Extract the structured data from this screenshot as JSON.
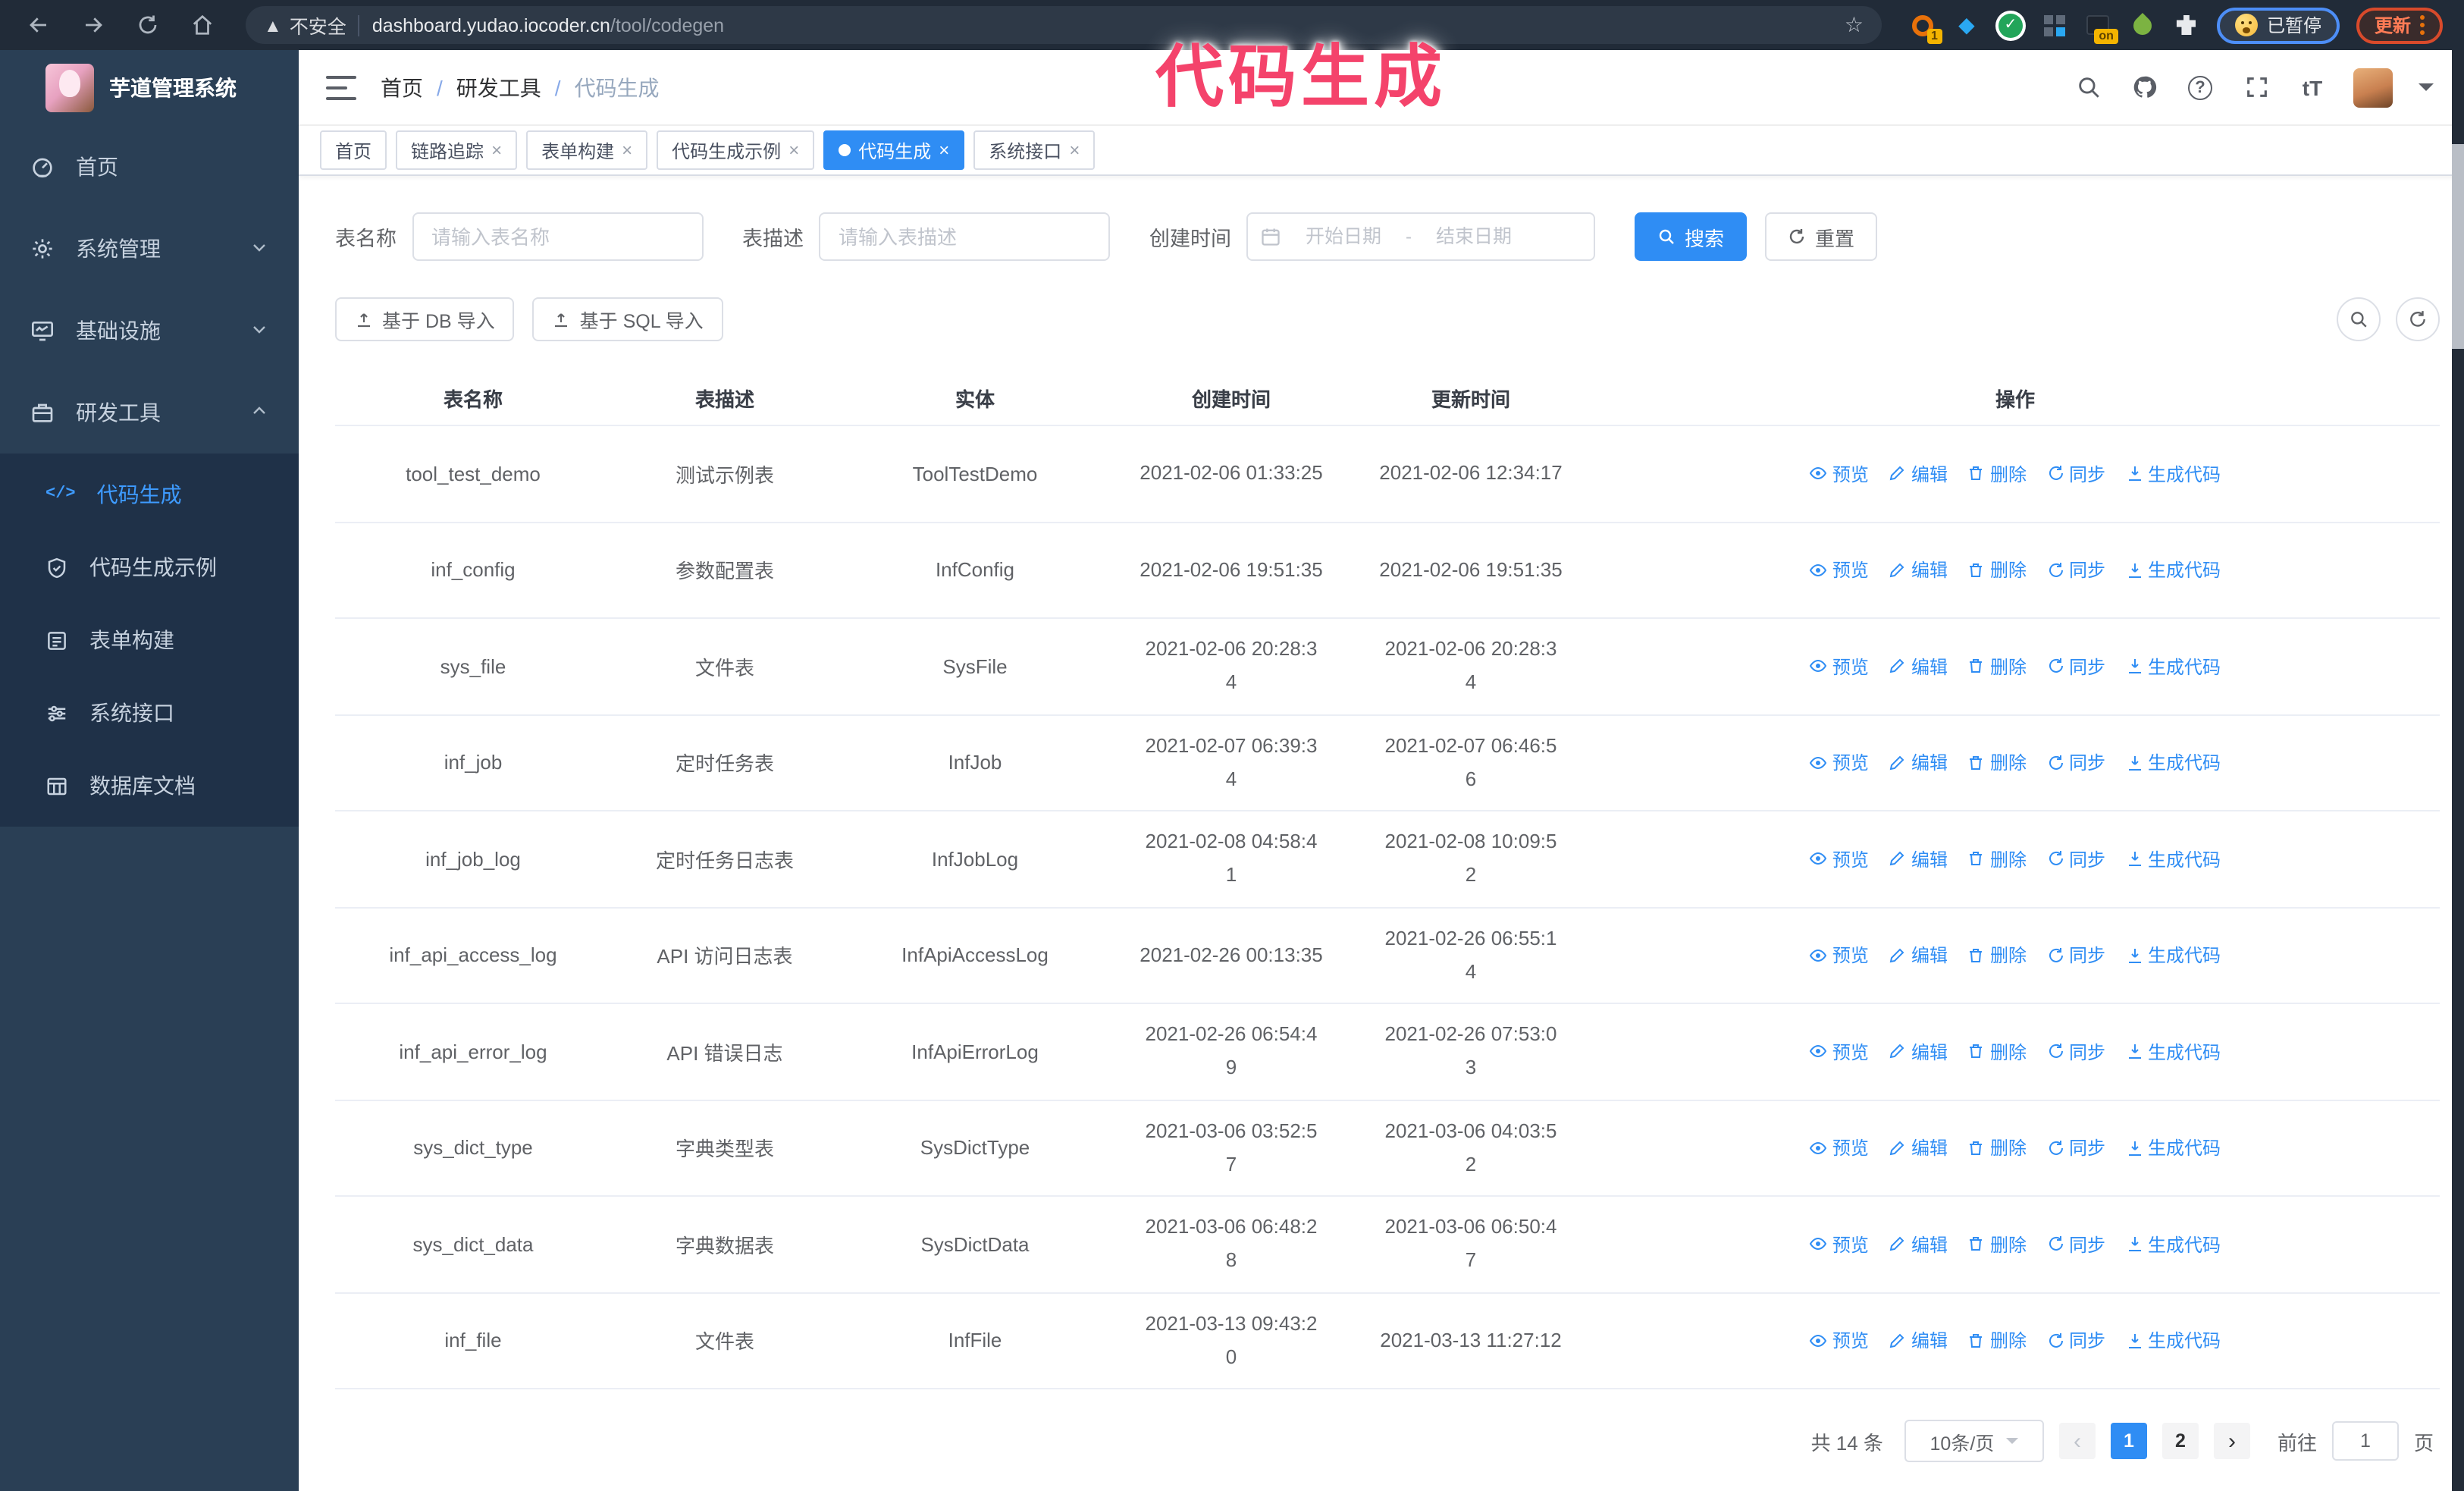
{
  "colors": {
    "accent": "#2f8df4",
    "overlay_pink": "#f4436b",
    "sidebar_bg": "#2a3f55",
    "submenu_bg": "#1f3148",
    "chrome_bg": "#212b38"
  },
  "browser": {
    "security_label": "不安全",
    "url_host": "dashboard.yudao.iocoder.cn",
    "url_path": "/tool/codegen",
    "extension_badge_1": "1",
    "extension_badge_on": "on",
    "paused_badge": "已暂停",
    "update_badge": "更新"
  },
  "overlay": {
    "title": "代码生成"
  },
  "sidebar": {
    "app_title": "芋道管理系统",
    "items": [
      {
        "label": "首页",
        "icon": "dashboard-icon",
        "expandable": false
      },
      {
        "label": "系统管理",
        "icon": "gear-icon",
        "expandable": true
      },
      {
        "label": "基础设施",
        "icon": "monitor-icon",
        "expandable": true
      },
      {
        "label": "研发工具",
        "icon": "toolbox-icon",
        "expandable": true,
        "expanded": true
      }
    ],
    "subitems": [
      {
        "label": "代码生成",
        "icon": "code-icon",
        "active": true
      },
      {
        "label": "代码生成示例",
        "icon": "badge-check-icon",
        "active": false
      },
      {
        "label": "表单构建",
        "icon": "form-icon",
        "active": false
      },
      {
        "label": "系统接口",
        "icon": "sliders-icon",
        "active": false
      },
      {
        "label": "数据库文档",
        "icon": "db-table-icon",
        "active": false
      }
    ]
  },
  "header": {
    "breadcrumb": {
      "items": [
        "首页",
        "研发工具",
        "代码生成"
      ],
      "separator": "/"
    }
  },
  "tabs": [
    {
      "label": "首页",
      "closable": false,
      "active": false
    },
    {
      "label": "链路追踪",
      "closable": true,
      "active": false
    },
    {
      "label": "表单构建",
      "closable": true,
      "active": false
    },
    {
      "label": "代码生成示例",
      "closable": true,
      "active": false
    },
    {
      "label": "代码生成",
      "closable": true,
      "active": true
    },
    {
      "label": "系统接口",
      "closable": true,
      "active": false
    }
  ],
  "filters": {
    "table_name_label": "表名称",
    "table_name_placeholder": "请输入表名称",
    "table_desc_label": "表描述",
    "table_desc_placeholder": "请输入表描述",
    "create_time_label": "创建时间",
    "start_placeholder": "开始日期",
    "range_separator": "-",
    "end_placeholder": "结束日期",
    "search_label": "搜索",
    "reset_label": "重置"
  },
  "toolbar": {
    "import_db_label": "基于 DB 导入",
    "import_sql_label": "基于 SQL 导入"
  },
  "table": {
    "columns": [
      "表名称",
      "表描述",
      "实体",
      "创建时间",
      "更新时间",
      "操作"
    ],
    "actions": {
      "preview": "预览",
      "edit": "编辑",
      "delete": "删除",
      "sync": "同步",
      "generate": "生成代码"
    },
    "rows": [
      {
        "name": "tool_test_demo",
        "desc": "测试示例表",
        "entity": "ToolTestDemo",
        "created": "2021-02-06 01:33:25",
        "updated": "2021-02-06 12:34:17"
      },
      {
        "name": "inf_config",
        "desc": "参数配置表",
        "entity": "InfConfig",
        "created": "2021-02-06 19:51:35",
        "updated": "2021-02-06 19:51:35"
      },
      {
        "name": "sys_file",
        "desc": "文件表",
        "entity": "SysFile",
        "created": "2021-02-06 20:28:3\n4",
        "updated": "2021-02-06 20:28:3\n4"
      },
      {
        "name": "inf_job",
        "desc": "定时任务表",
        "entity": "InfJob",
        "created": "2021-02-07 06:39:3\n4",
        "updated": "2021-02-07 06:46:5\n6"
      },
      {
        "name": "inf_job_log",
        "desc": "定时任务日志表",
        "entity": "InfJobLog",
        "created": "2021-02-08 04:58:4\n1",
        "updated": "2021-02-08 10:09:5\n2"
      },
      {
        "name": "inf_api_access_log",
        "desc": "API 访问日志表",
        "entity": "InfApiAccessLog",
        "created": "2021-02-26 00:13:35",
        "updated": "2021-02-26 06:55:1\n4"
      },
      {
        "name": "inf_api_error_log",
        "desc": "API 错误日志",
        "entity": "InfApiErrorLog",
        "created": "2021-02-26 06:54:4\n9",
        "updated": "2021-02-26 07:53:0\n3"
      },
      {
        "name": "sys_dict_type",
        "desc": "字典类型表",
        "entity": "SysDictType",
        "created": "2021-03-06 03:52:5\n7",
        "updated": "2021-03-06 04:03:5\n2"
      },
      {
        "name": "sys_dict_data",
        "desc": "字典数据表",
        "entity": "SysDictData",
        "created": "2021-03-06 06:48:2\n8",
        "updated": "2021-03-06 06:50:4\n7"
      },
      {
        "name": "inf_file",
        "desc": "文件表",
        "entity": "InfFile",
        "created": "2021-03-13 09:43:2\n0",
        "updated": "2021-03-13 11:27:12"
      }
    ]
  },
  "pagination": {
    "total_label": "共 14 条",
    "page_size": "10条/页",
    "pages": [
      "1",
      "2"
    ],
    "active_page": "1",
    "goto_label": "前往",
    "goto_value": "1",
    "page_unit": "页"
  }
}
